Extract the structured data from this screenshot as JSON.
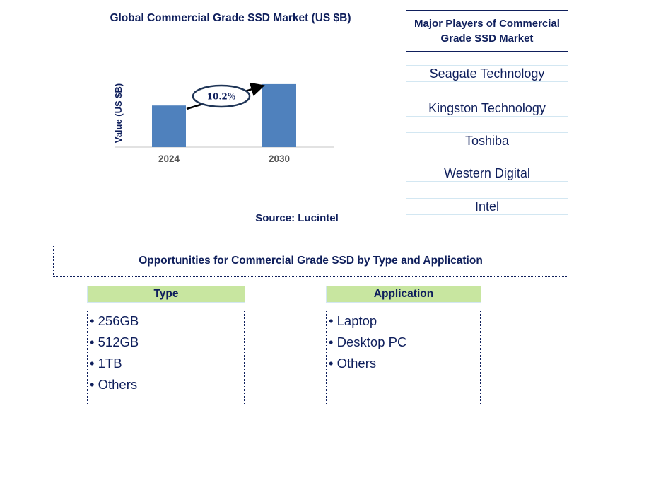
{
  "chart_data": {
    "type": "bar",
    "title": "Global Commercial Grade SSD Market (US $B)",
    "categories": [
      "2024",
      "2030"
    ],
    "values": [
      0.66,
      1.0
    ],
    "value_note": "relative bar heights only; no numeric axis shown",
    "ylabel": "Value (US $B)",
    "xlabel": "",
    "ylim": [
      0,
      1.1
    ],
    "grid": false,
    "annotation": {
      "label": "10.2%",
      "type": "CAGR arrow from 2024 to 2030"
    },
    "bar_color": "#4f81bd",
    "source": "Source: Lucintel"
  },
  "players": {
    "title": "Major Players of Commercial Grade SSD Market",
    "items": [
      "Seagate Technology",
      "Kingston Technology",
      "Toshiba",
      "Western Digital",
      "Intel"
    ]
  },
  "opportunities": {
    "title": "Opportunities for Commercial Grade SSD by Type and Application",
    "type": {
      "header": "Type",
      "items": [
        "• 256GB",
        "• 512GB",
        "• 1TB",
        "• Others"
      ]
    },
    "application": {
      "header": "Application",
      "items": [
        "• Laptop",
        "• Desktop PC",
        "• Others"
      ]
    }
  },
  "colors": {
    "navy": "#0f1f5c",
    "accent_yellow": "#f5b800",
    "header_green": "#c8e6a0",
    "bar_blue": "#4f81bd"
  }
}
